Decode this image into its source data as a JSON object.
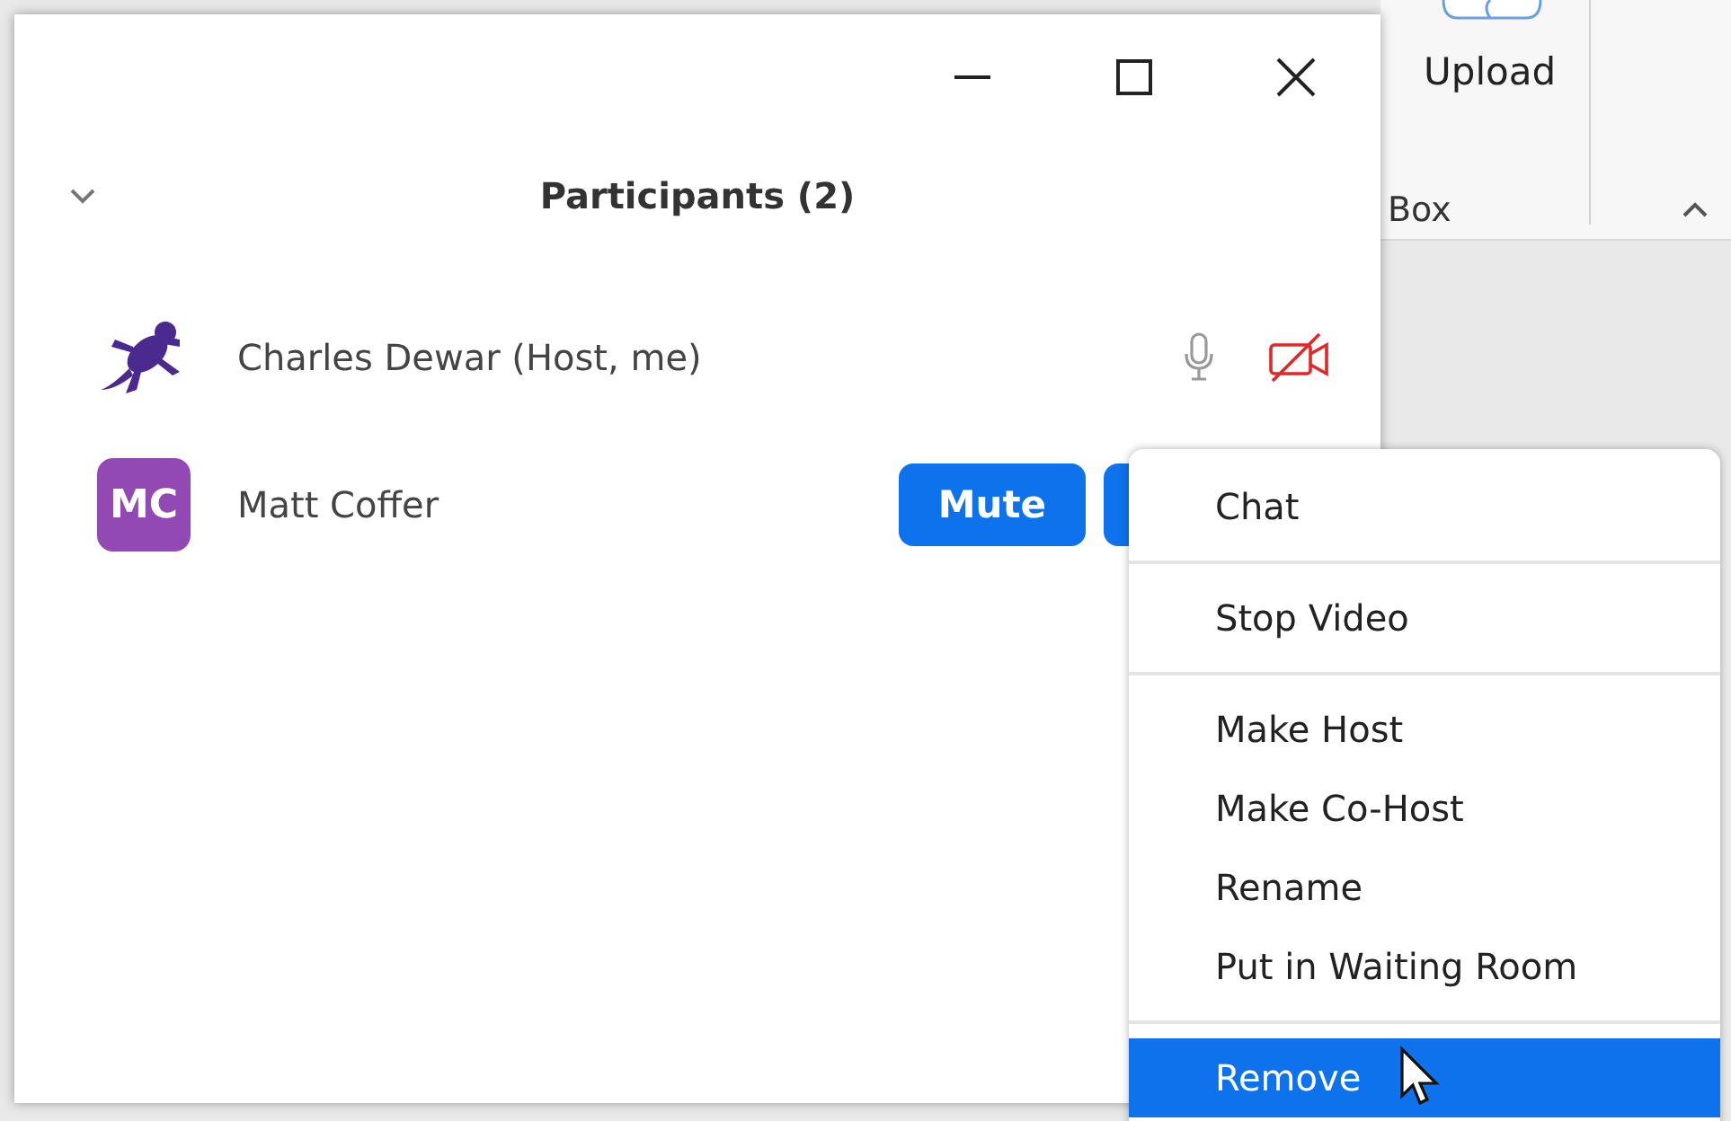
{
  "ribbon": {
    "button_label": "Upload",
    "group_label": "Box"
  },
  "panel": {
    "title": "Participants (2)"
  },
  "participants": [
    {
      "name": "Charles Dewar (Host, me)",
      "mic_muted": false,
      "video_on": false
    },
    {
      "name": "Matt Coffer",
      "avatar": {
        "kind": "initials",
        "text": "MC",
        "color": "#9249b3"
      },
      "actions": [
        "Mute"
      ]
    }
  ],
  "context_menu": {
    "groups": [
      [
        {
          "label": "Chat",
          "selected": false
        }
      ],
      [
        {
          "label": "Stop Video",
          "selected": false
        }
      ],
      [
        {
          "label": "Make Host",
          "selected": false
        },
        {
          "label": "Make Co-Host",
          "selected": false
        },
        {
          "label": "Rename",
          "selected": false
        },
        {
          "label": "Put in Waiting Room",
          "selected": false
        }
      ],
      [
        {
          "label": "Remove",
          "selected": true
        }
      ]
    ]
  }
}
